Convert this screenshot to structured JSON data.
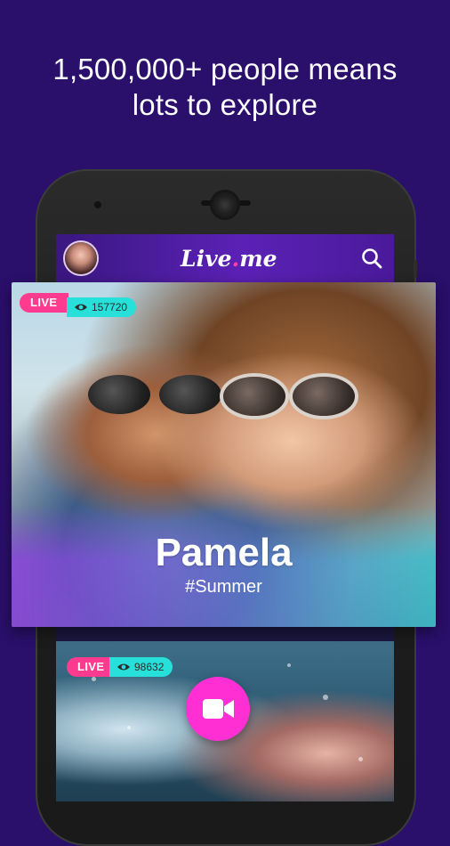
{
  "headline": {
    "line1": "1,500,000+ people means",
    "line2": "lots to explore"
  },
  "app": {
    "logo_text": "Live",
    "logo_dot": ".",
    "logo_suffix": "me"
  },
  "featured": {
    "live_label": "LIVE",
    "viewers": "157720",
    "name": "Pamela",
    "tag": "#Summer"
  },
  "second": {
    "live_label": "LIVE",
    "viewers": "98632"
  },
  "colors": {
    "background": "#2a0f6b",
    "live_pink": "#ff3b8f",
    "viewer_cyan": "#27e0da",
    "record_button": "#ff2fd3"
  },
  "icons": {
    "search": "search-icon",
    "eye": "eye-icon",
    "record": "video-camera-icon"
  }
}
